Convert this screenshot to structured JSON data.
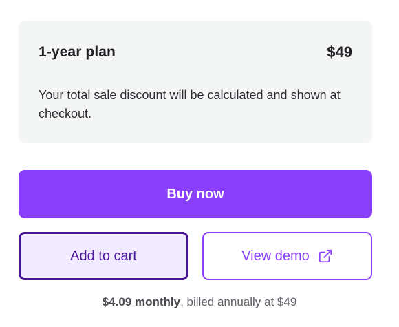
{
  "plan": {
    "name": "1-year plan",
    "price": "$49",
    "note": "Your total sale discount will be calculated and shown at checkout."
  },
  "actions": {
    "buy_label": "Buy now",
    "cart_label": "Add to cart",
    "demo_label": "View demo",
    "demo_icon": "external-link-icon"
  },
  "billing": {
    "monthly": "$4.09 monthly",
    "rest": ", billed annually at $49"
  },
  "colors": {
    "accent": "#8a3ffc",
    "accent_dark": "#4a1596",
    "accent_light": "#f1ebff",
    "card_bg": "#f4f5f5"
  }
}
